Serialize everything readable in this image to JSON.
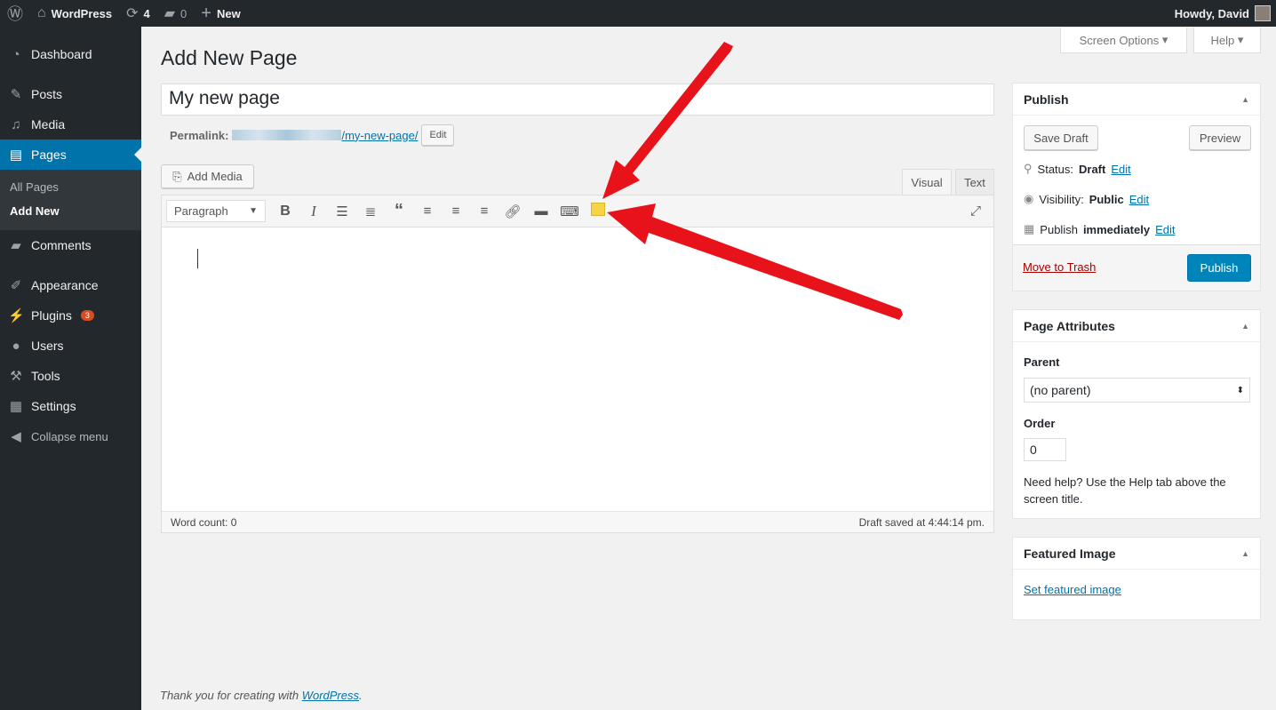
{
  "adminbar": {
    "site": "WordPress",
    "updates": "4",
    "comments": "0",
    "new": "New",
    "greeting": "Howdy, David"
  },
  "sidebar": {
    "items": [
      {
        "label": "Dashboard",
        "icon": "dashboard-icon"
      },
      {
        "label": "Posts",
        "icon": "pin-icon"
      },
      {
        "label": "Media",
        "icon": "media-icon"
      },
      {
        "label": "Pages",
        "icon": "pages-icon"
      },
      {
        "label": "Comments",
        "icon": "comment-icon"
      },
      {
        "label": "Appearance",
        "icon": "brush-icon"
      },
      {
        "label": "Plugins",
        "icon": "plugin-icon",
        "badge": "3"
      },
      {
        "label": "Users",
        "icon": "user-icon"
      },
      {
        "label": "Tools",
        "icon": "wrench-icon"
      },
      {
        "label": "Settings",
        "icon": "settings-icon"
      }
    ],
    "sub": [
      "All Pages",
      "Add New"
    ],
    "collapse": "Collapse menu"
  },
  "screen_options": "Screen Options",
  "help": "Help",
  "page_title": "Add New Page",
  "title_value": "My new page",
  "permalink": {
    "label": "Permalink:",
    "slug": "/my-new-page/",
    "edit": "Edit"
  },
  "add_media": "Add Media",
  "editor": {
    "tab_visual": "Visual",
    "tab_text": "Text",
    "format": "Paragraph",
    "word_count": "Word count: 0",
    "draft_saved": "Draft saved at 4:44:14 pm."
  },
  "publish": {
    "title": "Publish",
    "save_draft": "Save Draft",
    "preview": "Preview",
    "status_label": "Status:",
    "status": "Draft",
    "visibility_label": "Visibility:",
    "visibility": "Public",
    "publish_label": "Publish",
    "publish_when": "immediately",
    "edit": "Edit",
    "trash": "Move to Trash",
    "publish_btn": "Publish"
  },
  "attributes": {
    "title": "Page Attributes",
    "parent_label": "Parent",
    "parent_value": "(no parent)",
    "order_label": "Order",
    "order_value": "0",
    "help": "Need help? Use the Help tab above the screen title."
  },
  "featured": {
    "title": "Featured Image",
    "link": "Set featured image"
  },
  "footer": {
    "text": "Thank you for creating with ",
    "link": "WordPress",
    "end": "."
  },
  "colors": {
    "accent": "#0073aa",
    "primary_button": "#0085ba",
    "annotation_arrow": "#e8121a"
  }
}
